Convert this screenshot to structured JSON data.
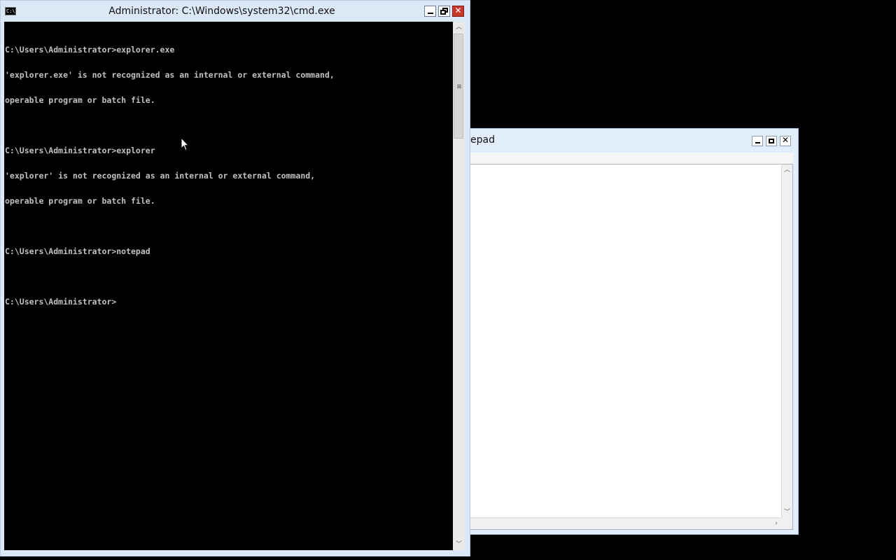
{
  "notepad": {
    "title_visible": "epad",
    "buttons": {
      "minimize": "minimize",
      "maximize": "maximize",
      "close": "✕"
    }
  },
  "cmd": {
    "title": "Administrator: C:\\Windows\\system32\\cmd.exe",
    "icon_text": "C:\\.",
    "lines": [
      "C:\\Users\\Administrator>explorer.exe",
      "'explorer.exe' is not recognized as an internal or external command,",
      "operable program or batch file.",
      "",
      "C:\\Users\\Administrator>explorer",
      "'explorer' is not recognized as an internal or external command,",
      "operable program or batch file.",
      "",
      "C:\\Users\\Administrator>notepad",
      "",
      "C:\\Users\\Administrator>"
    ],
    "close_glyph": "✕"
  },
  "colors": {
    "title_bar": "#dbe8f6",
    "console_bg": "#000000",
    "console_fg": "#c0c0c0",
    "close_button": "#c7382b"
  }
}
